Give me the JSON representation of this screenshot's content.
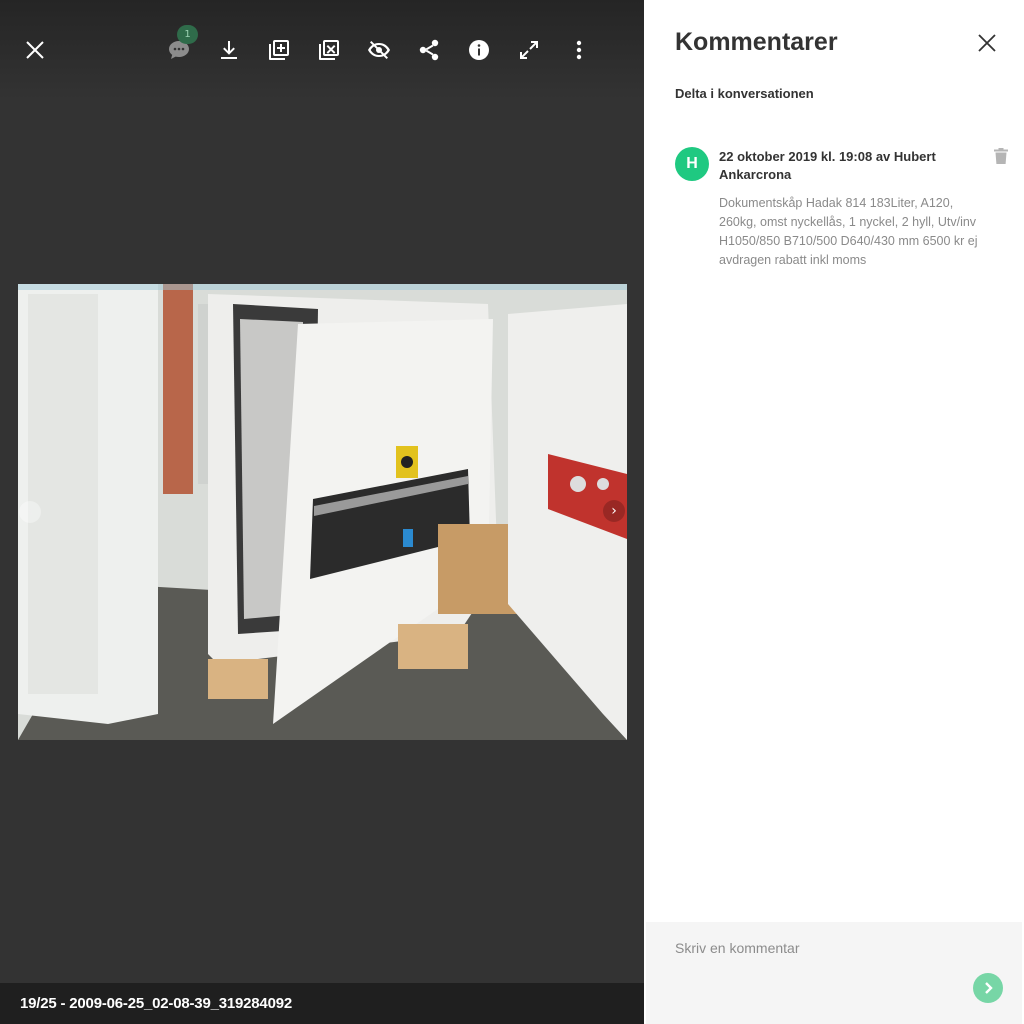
{
  "viewer": {
    "toolbar": {
      "close": "close-icon",
      "comments": {
        "icon": "comment-icon",
        "count": "1"
      },
      "download": "download-icon",
      "add_to_album": "add-to-album-icon",
      "remove_from_album": "remove-from-album-icon",
      "hide": "eye-off-icon",
      "share": "share-icon",
      "info": "info-icon",
      "fullscreen": "fullscreen-icon",
      "more": "more-vertical-icon"
    },
    "prev_arrow": "‹",
    "next_arrow": "›",
    "footer_caption": "19/25 - 2009-06-25_02-08-39_319284092"
  },
  "comments_panel": {
    "title": "Kommentarer",
    "subtitle": "Delta i konversationen",
    "comments": [
      {
        "avatar_initial": "H",
        "avatar_color": "#1fc981",
        "header": "22 oktober 2019 kl. 19:08 av Hubert Ankarcrona",
        "body": "Dokumentskåp Hadak 814 183Liter, A120, 260kg, omst nyckellås, 1 nyckel, 2 hyll, Utv/inv H1050/850 B710/500 D640/430 mm 6500 kr ej avdragen rabatt inkl moms"
      }
    ],
    "composer": {
      "placeholder": "Skriv en kommentar",
      "send_icon": "send-icon"
    }
  },
  "colors": {
    "accent": "#1fc981",
    "send_button": "#77d6a6",
    "viewer_bg": "#333333"
  }
}
